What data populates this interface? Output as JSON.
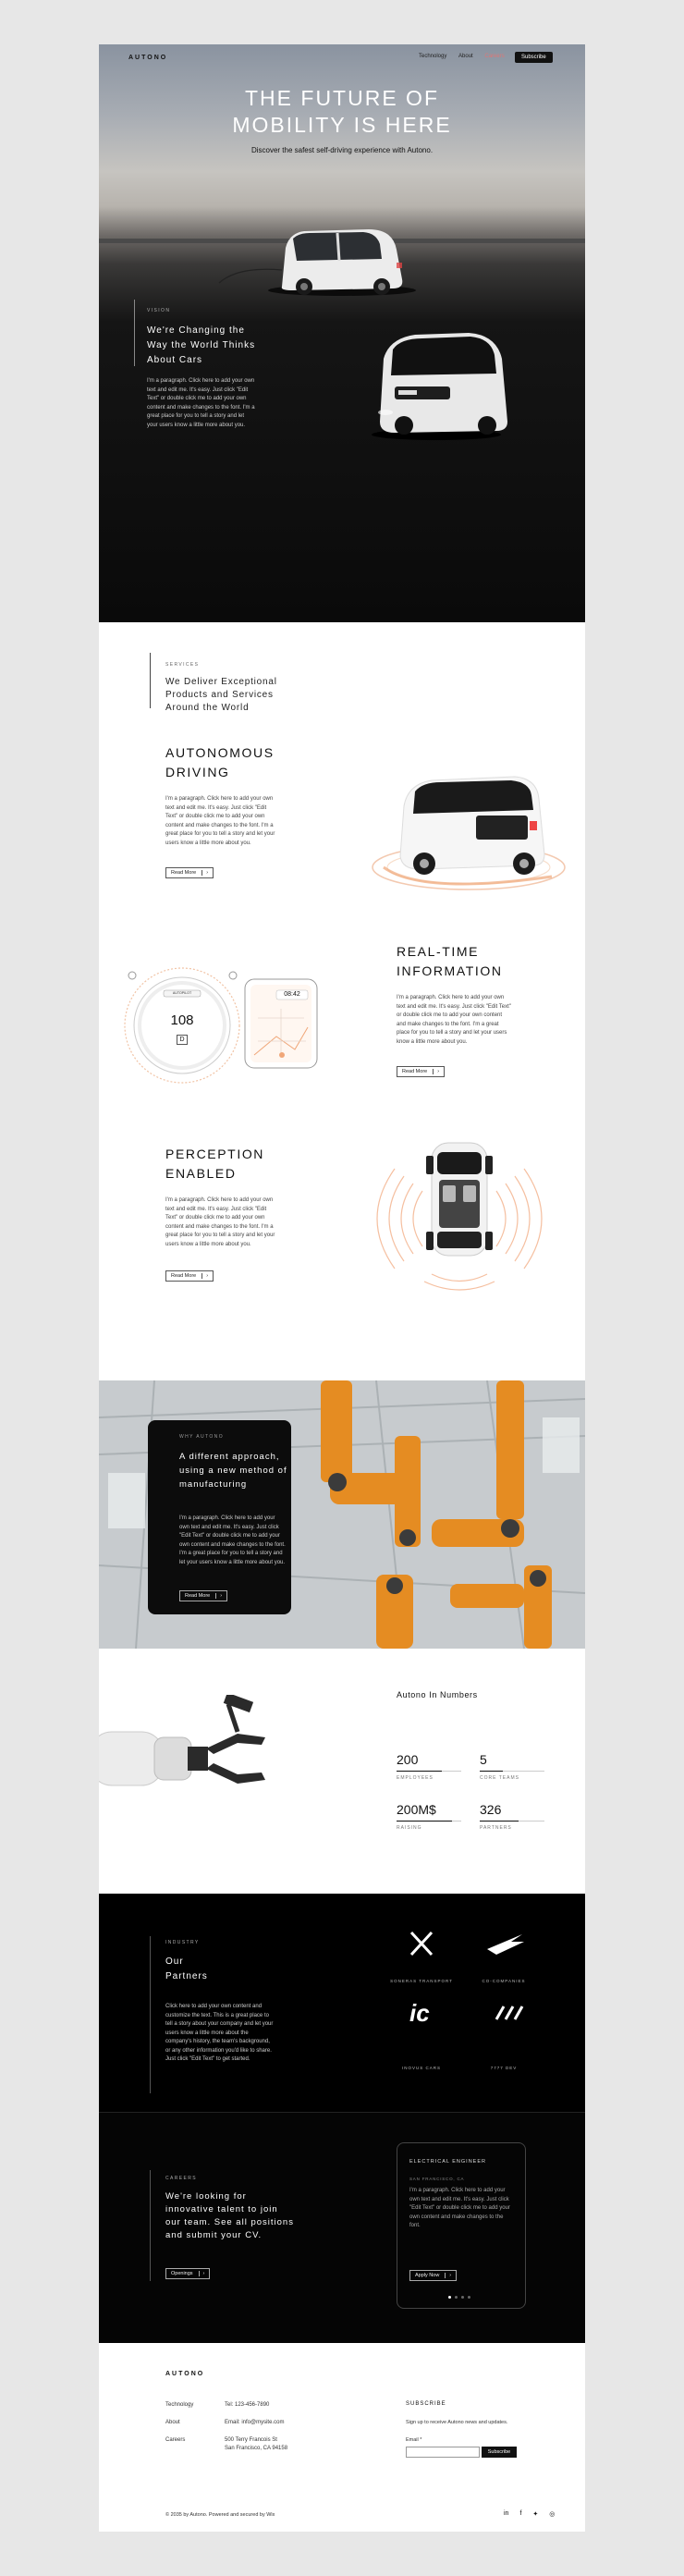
{
  "header": {
    "logo": "AUTONO",
    "nav": [
      "Technology",
      "About",
      "Careers"
    ],
    "subscribe_label": "Subscribe",
    "title_line1": "THE FUTURE OF",
    "title_line2": "MOBILITY IS HERE",
    "subtitle": "Discover the safest self-driving experience with Autono."
  },
  "vision": {
    "eyebrow": "VISION",
    "heading": [
      "We're Changing the",
      "Way the World Thinks",
      "About Cars"
    ],
    "body": "I'm a paragraph. Click here to add your own text and edit me. It's easy. Just click \"Edit Text\" or double click me to add your own content and make changes to the font. I'm a great place for you to tell a story and let your users know a little more about you."
  },
  "services": {
    "eyebrow": "SERVICES",
    "heading": [
      "We Deliver Exceptional",
      "Products and Services",
      "Around the World"
    ]
  },
  "features": [
    {
      "title": [
        "AUTONOMOUS",
        "DRIVING"
      ],
      "body": "I'm a paragraph. Click here to add your own text and edit me. It's easy. Just click \"Edit Text\" or double click me to add your own content and make changes to the font. I'm a great place for you to tell a story and let your users know a little more about you.",
      "button": "Read More"
    },
    {
      "title": [
        "REAL-TIME",
        "INFORMATION"
      ],
      "body": "I'm a paragraph. Click here to add your own text and edit me. It's easy. Just click \"Edit Text\" or double click me to add your own content and make changes to the font. I'm a great place for you to tell a story and let your users know a little more about you.",
      "button": "Read More"
    },
    {
      "title": [
        "PERCEPTION",
        "ENABLED"
      ],
      "body": "I'm a paragraph. Click here to add your own text and edit me. It's easy. Just click \"Edit Text\" or double click me to add your own content and make changes to the font. I'm a great place for you to tell a story and let your users know a little more about you.",
      "button": "Read More"
    }
  ],
  "dashboard": {
    "speed": "108",
    "gear": "D",
    "time": "08:42",
    "mode_label": "AUTOPILOT"
  },
  "why": {
    "eyebrow": "WHY AUTONO",
    "heading": [
      "A different approach,",
      "using a new method of",
      "manufacturing"
    ],
    "body": "I'm a paragraph. Click here to add your own text and edit me. It's easy. Just click \"Edit Text\" or double click me to add your own content and make changes to the font. I'm a great place for you to tell a story and let your users know a little more about you.",
    "button": "Read More"
  },
  "numbers": {
    "title": "Autono In Numbers",
    "stats": [
      {
        "value": "200",
        "label": "EMPLOYEES",
        "fill": 0.7
      },
      {
        "value": "5",
        "label": "CORE TEAMS",
        "fill": 0.35
      },
      {
        "value": "200M$",
        "label": "RAISING",
        "fill": 0.85
      },
      {
        "value": "326",
        "label": "PARTNERS",
        "fill": 0.6
      }
    ]
  },
  "partners": {
    "eyebrow": "INDUSTRY",
    "heading": [
      "Our",
      "Partners"
    ],
    "body": "Click here to add your own content and customize the text. This is a great place to tell a story about your company and let your users know a little more about the company's history, the team's background, or any other information you'd like to share. Just click \"Edit Text\" to get started.",
    "logos": [
      {
        "name": "SONERAS TRANSPORT",
        "icon": "x-logo-icon"
      },
      {
        "name": "CO-COMPANIES",
        "icon": "wing-logo-icon"
      },
      {
        "name": "INOVUS CARS",
        "icon": "ic-logo-icon"
      },
      {
        "name": "7777 DEV",
        "icon": "slash-logo-icon"
      }
    ]
  },
  "careers": {
    "eyebrow": "CAREERS",
    "heading": [
      "We're looking for",
      "innovative talent to join",
      "our team. See all positions",
      "and submit your CV."
    ],
    "button": "Openings",
    "card_title": "ELECTRICAL ENGINEER",
    "card_location": "SAN FRANCISCO, CA",
    "card_body": "I'm a paragraph. Click here to add your own text and edit me. It's easy. Just click \"Edit Text\" or double click me to add your own content and make changes to the font.",
    "card_button": "Apply Now"
  },
  "footer": {
    "logo": "AUTONO",
    "links": [
      "Technology",
      "About",
      "Careers"
    ],
    "tel": "Tel: 123-456-7890",
    "email": "Email: info@mysite.com",
    "address_line1": "500 Terry Francois St",
    "address_line2": "San Francisco, CA 94158",
    "subscribe_title": "SUBSCRIBE",
    "subscribe_sub": "Sign up to receive Autono news and updates.",
    "email_label": "Email *",
    "subscribe_button": "Subscribe",
    "copyright": "© 2035 by Autono. Powered and secured by Wix",
    "socials": [
      "linkedin-icon",
      "facebook-icon",
      "twitter-icon",
      "instagram-icon"
    ]
  }
}
